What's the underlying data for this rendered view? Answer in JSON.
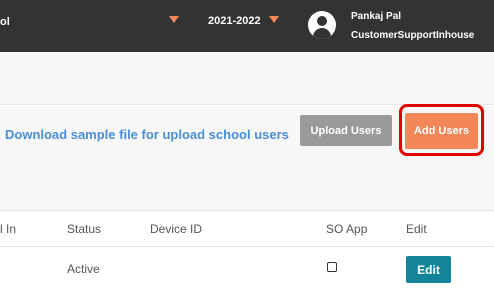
{
  "header": {
    "school_fragment": "ol",
    "academic_year": "2021-2022",
    "user_name": "Pankaj Pal",
    "user_role": "CustomerSupportInhouse"
  },
  "actions": {
    "download_link": "Download sample file for upload school users",
    "upload_button": "Upload Users",
    "add_button": "Add Users"
  },
  "table": {
    "columns": [
      "l In",
      "Status",
      "Device ID",
      "SO App",
      "Edit"
    ],
    "rows": [
      {
        "status": "Active",
        "device_id": "",
        "so_app": false,
        "edit": "Edit"
      }
    ]
  },
  "colors": {
    "accent": "#f4875a",
    "link": "#4a8fd6",
    "edit": "#12859b",
    "topbar": "#333333",
    "highlight": "#e00000"
  }
}
